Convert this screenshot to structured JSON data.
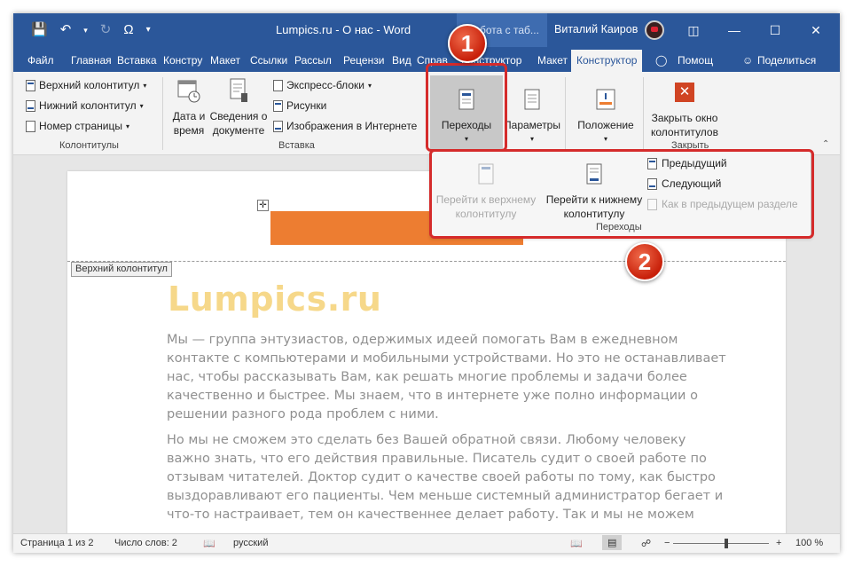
{
  "title_bar": {
    "doc_title": "Lumpics.ru - О нас  -  Word",
    "context_tab": "бота с таб...",
    "user_name": "Виталий Каиров",
    "qat_save_icon": "save-icon",
    "qat_undo_icon": "undo-icon",
    "qat_redo_icon": "redo-icon",
    "qat_symbol": "Ω"
  },
  "tabs": [
    "Файл",
    "Главная",
    "Вставка",
    "Констру",
    "Макет",
    "Ссылки",
    "Рассыл",
    "Рецензи",
    "Вид",
    "Справ",
    "Конструктор",
    "Макет",
    "Конструктор",
    "Помощ",
    "Поделиться"
  ],
  "ribbon": {
    "groups": {
      "headers": {
        "label": "Колонтитулы",
        "items": [
          "Верхний колонтитул",
          "Нижний колонтитул",
          "Номер страницы"
        ]
      },
      "insert": {
        "label": "Вставка",
        "date_time": [
          "Дата и",
          "время"
        ],
        "doc_info": [
          "Сведения о",
          "документе"
        ],
        "quick_parts": "Экспресс-блоки",
        "pictures": "Рисунки",
        "online_pictures": "Изображения в Интернете"
      },
      "navigation_btn": "Переходы",
      "options_btn": "Параметры",
      "position_btn": "Положение",
      "close": {
        "label": [
          "Закрыть окно",
          "колонтитулов"
        ],
        "group_label": "Закрыть"
      }
    }
  },
  "nav_panel": {
    "goto_header": [
      "Перейти к верхнему",
      "колонтитулу"
    ],
    "goto_footer": [
      "Перейти к нижнему",
      "колонтитулу"
    ],
    "previous": "Предыдущий",
    "next": "Следующий",
    "link_previous": "Как в предыдущем разделе",
    "group_label": "Переходы"
  },
  "document": {
    "header_tag": "Верхний колонтитул",
    "site_title": "Lumpics.ru",
    "para1": [
      "Мы — группа энтузиастов, одержимых идеей помогать Вам в ежедневном",
      "контакте с компьютерами и мобильными устройствами. Но это не останавливает",
      "нас, чтобы рассказывать Вам, как решать многие проблемы и задачи более",
      "качественно и быстрее. Мы знаем, что в интернете уже полно информации о",
      "решении разного рода проблем с ними."
    ],
    "para2": [
      "Но мы не сможем это сделать без Вашей обратной связи. Любому человеку",
      "важно знать, что его действия правильные. Писатель судит о своей работе по",
      "отзывам читателей. Доктор судит о качестве своей работы по тому, как быстро",
      "выздоравливают его пациенты. Чем меньше системный администратор бегает и",
      "что-то настраивает, тем он качественнее делает работу. Так и мы не можем"
    ]
  },
  "markers": [
    "1",
    "2"
  ],
  "status_bar": {
    "page": "Страница 1 из 2",
    "words": "Число слов: 2",
    "language": "русский",
    "zoom": "100 %",
    "zoom_minus": "−",
    "zoom_plus": "+"
  },
  "colors": {
    "word_blue": "#2b579a",
    "orange": "#ed7d31",
    "highlight_red": "#d52b2b",
    "title_yellow": "#f6d88a"
  }
}
